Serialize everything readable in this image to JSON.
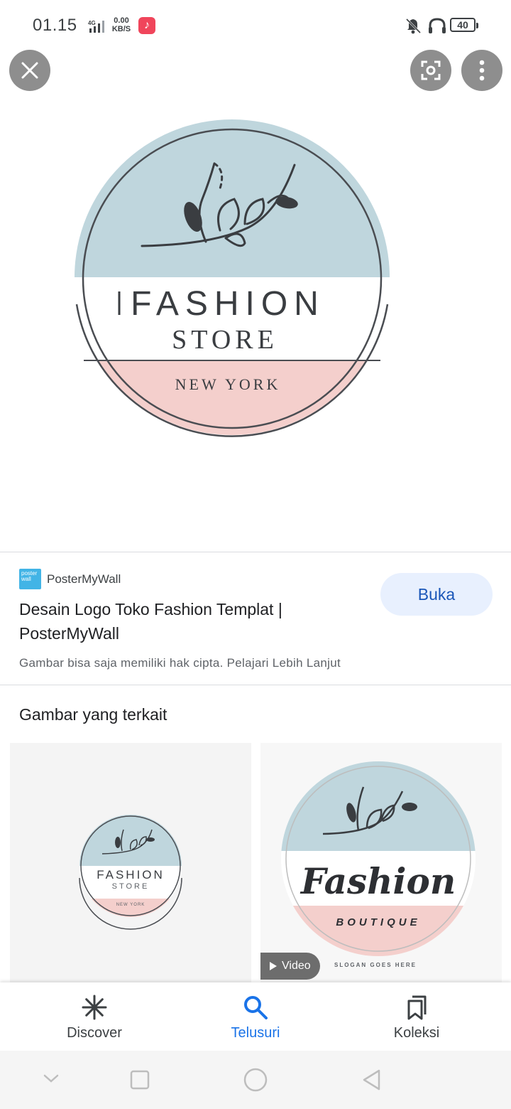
{
  "status_bar": {
    "time": "01.15",
    "network": "4G",
    "speed_value": "0.00",
    "speed_unit": "KB/S",
    "battery": "40"
  },
  "icons": {
    "close": "close-icon",
    "lens": "lens-icon",
    "more": "more-vert-icon",
    "music": "music-note-icon",
    "mute": "bell-off-icon",
    "headphones": "headphones-icon"
  },
  "hero_logo": {
    "line1": "FASHION",
    "line2": "STORE",
    "line3": "NEW YORK"
  },
  "result": {
    "source": "PosterMyWall",
    "source_logo_text": "poster wall",
    "title": "Desain Logo Toko Fashion Templat | PosterMyWall",
    "open_label": "Buka",
    "copyright": "Gambar bisa saja memiliki hak cipta. Pelajari Lebih Lanjut"
  },
  "related": {
    "heading": "Gambar yang terkait",
    "items": [
      {
        "line1": "FASHION",
        "line2": "STORE",
        "line3": "NEW YORK"
      },
      {
        "line1": "Fashion",
        "line2": "BOUTIQUE",
        "line3": "SLOGAN GOES HERE",
        "badge": "Video"
      }
    ]
  },
  "bottom_nav": [
    {
      "label": "Discover",
      "icon": "discover-icon",
      "active": false
    },
    {
      "label": "Telusuri",
      "icon": "search-icon",
      "active": true
    },
    {
      "label": "Koleksi",
      "icon": "collections-icon",
      "active": false
    }
  ],
  "colors": {
    "accent": "#1a73e8",
    "logo_blue": "#bfd6dd",
    "logo_pink": "#f4cfcc",
    "logo_dark": "#3a3d41"
  }
}
